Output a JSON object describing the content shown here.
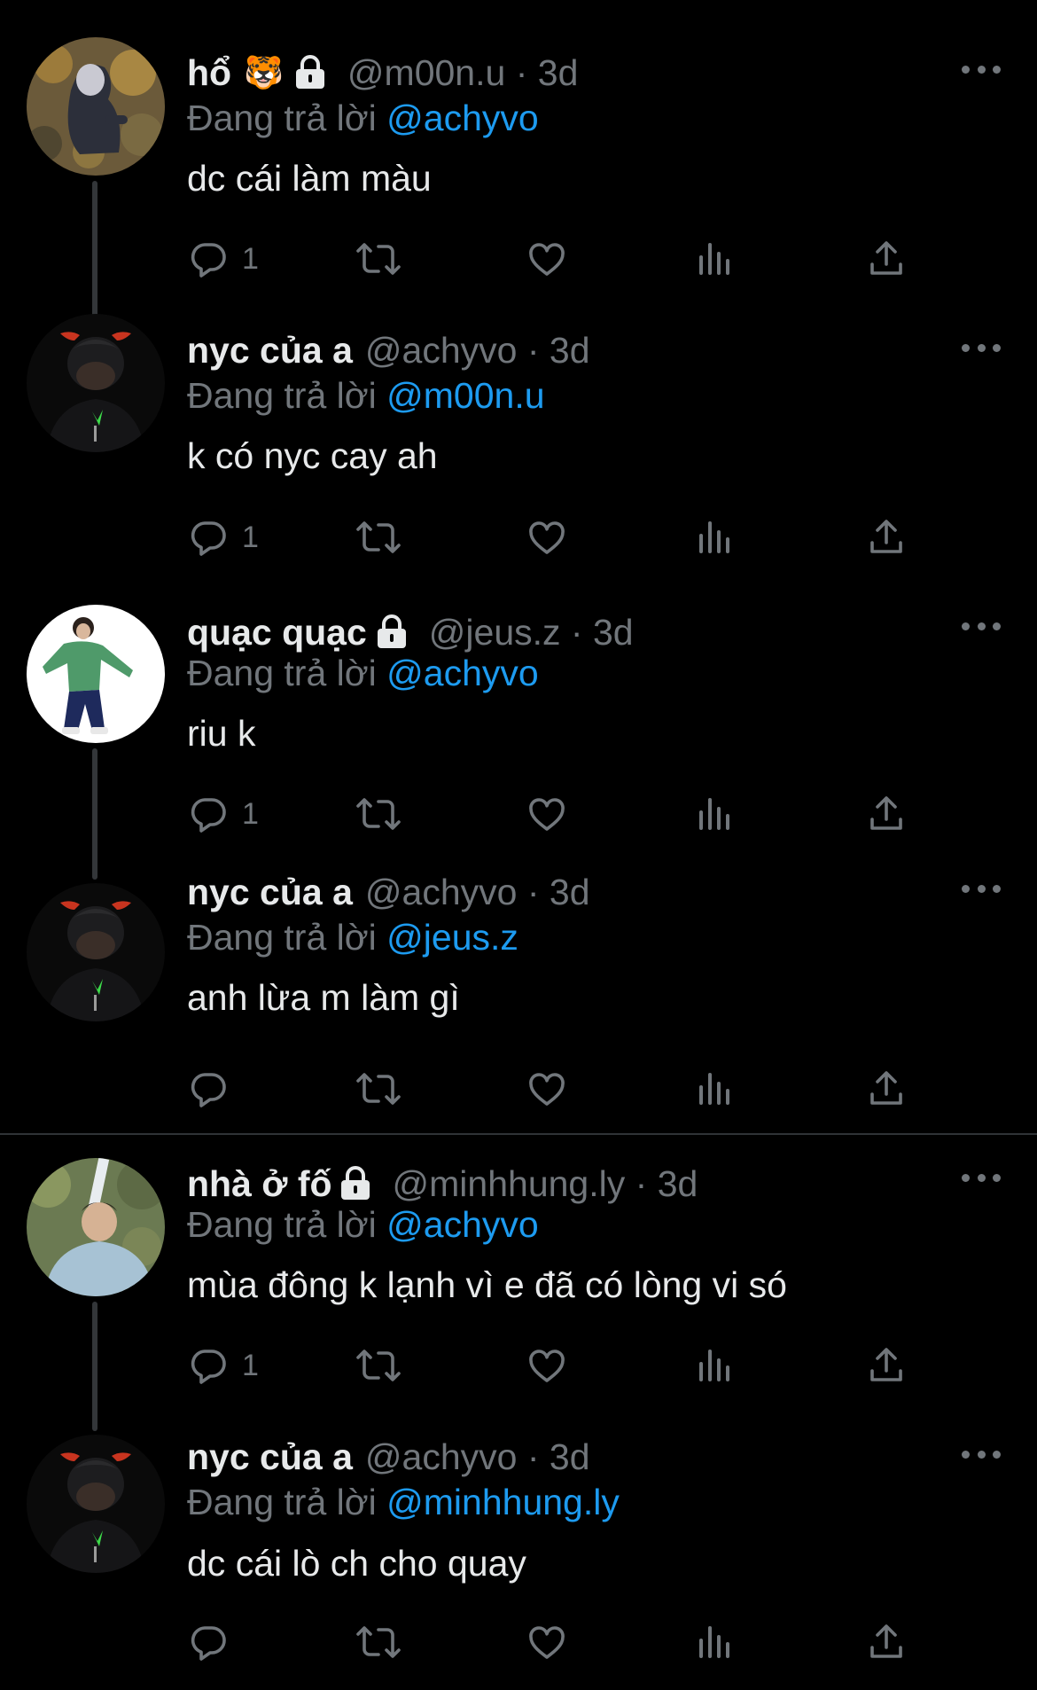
{
  "tweets": [
    {
      "display_name": "hổ",
      "emoji": "🐯",
      "locked": true,
      "handle": "@m00n.u",
      "time": "3d",
      "reply_prefix": "Đang trả lời",
      "reply_to": "@achyvo",
      "text": "dc cái làm màu",
      "reply_count": "1",
      "avatar": "person-hoodie-leaves"
    },
    {
      "display_name": "nyc của a",
      "emoji": "",
      "locked": false,
      "handle": "@achyvo",
      "time": "3d",
      "reply_prefix": "Đang trả lời",
      "reply_to": "@m00n.u",
      "text": "k có nyc cay ah",
      "reply_count": "1",
      "avatar": "person-devil-horns"
    },
    {
      "display_name": "quạc quạc",
      "emoji": "",
      "locked": true,
      "handle": "@jeus.z",
      "time": "3d",
      "reply_prefix": "Đang trả lời",
      "reply_to": "@achyvo",
      "text": "riu k",
      "reply_count": "1",
      "avatar": "person-green-jacket"
    },
    {
      "display_name": "nyc của a",
      "emoji": "",
      "locked": false,
      "handle": "@achyvo",
      "time": "3d",
      "reply_prefix": "Đang trả lời",
      "reply_to": "@jeus.z",
      "text": "anh lừa m làm gì",
      "reply_count": "",
      "avatar": "person-devil-horns"
    },
    {
      "display_name": "nhà ở fố",
      "emoji": "",
      "locked": true,
      "handle": "@minhhung.ly",
      "time": "3d",
      "reply_prefix": "Đang trả lời",
      "reply_to": "@achyvo",
      "text": "mùa đông k lạnh vì e đã có lòng vi só",
      "reply_count": "1",
      "avatar": "person-light-blue-hoodie"
    },
    {
      "display_name": "nyc của a",
      "emoji": "",
      "locked": false,
      "handle": "@achyvo",
      "time": "3d",
      "reply_prefix": "Đang trả lời",
      "reply_to": "@minhhung.ly",
      "text": "dc cái lò ch cho quay",
      "reply_count": "",
      "avatar": "person-devil-horns"
    }
  ],
  "separator": "·",
  "colors": {
    "background": "#000000",
    "text": "#e7e9ea",
    "secondary": "#71767b",
    "mention": "#1d9bf0",
    "thread_line": "#333639"
  },
  "icons": [
    "reply-icon",
    "retweet-icon",
    "like-icon",
    "views-icon",
    "share-icon",
    "lock-icon",
    "more-icon"
  ]
}
